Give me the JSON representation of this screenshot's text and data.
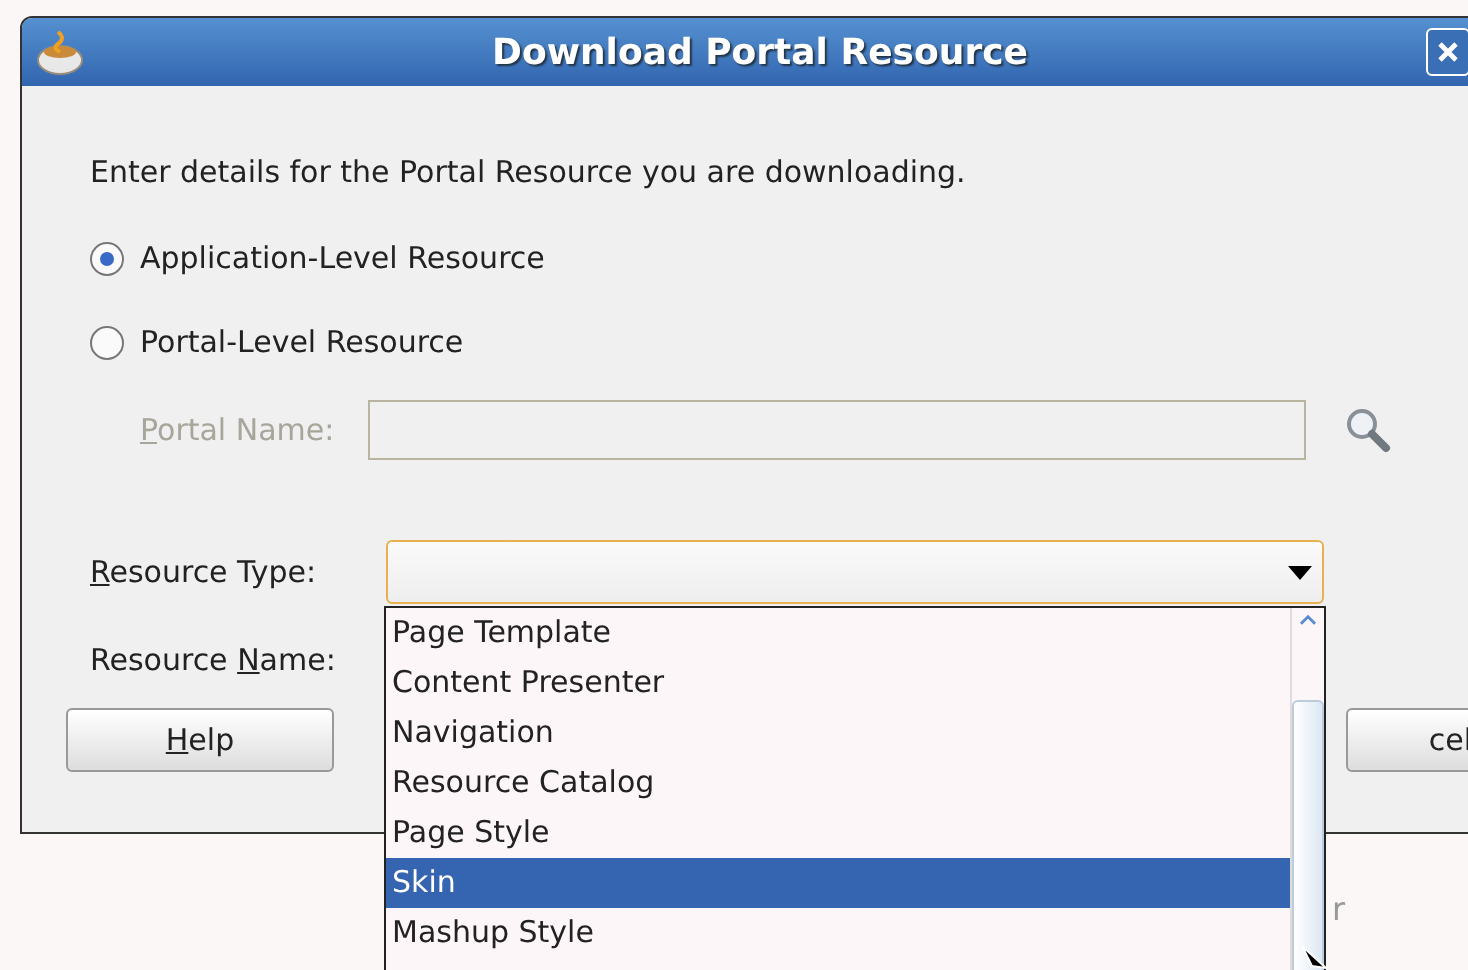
{
  "window": {
    "title": "Download Portal Resource"
  },
  "intro": "Enter details for the Portal Resource you are downloading.",
  "radios": [
    {
      "label": "Application-Level Resource",
      "selected": true
    },
    {
      "label": "Portal-Level Resource",
      "selected": false
    }
  ],
  "portal_name": {
    "label": {
      "key": "P",
      "post": "ortal Name:"
    },
    "disabled": true
  },
  "resource_type": {
    "label": {
      "key": "R",
      "post": "esource Type:"
    }
  },
  "resource_name": {
    "label": {
      "pre": "Resource ",
      "key": "N",
      "post": "ame:"
    }
  },
  "dropdown": {
    "items": [
      {
        "label": "Page Template",
        "selected": false
      },
      {
        "label": "Content Presenter",
        "selected": false
      },
      {
        "label": "Navigation",
        "selected": false
      },
      {
        "label": "Resource Catalog",
        "selected": false
      },
      {
        "label": "Page Style",
        "selected": false
      },
      {
        "label": "Skin",
        "selected": true
      },
      {
        "label": "Mashup Style",
        "selected": false
      }
    ]
  },
  "buttons": [
    {
      "kind": "help",
      "label": {
        "key": "H",
        "post": "elp"
      }
    },
    {
      "kind": "cancel",
      "label": {
        "post": "cel"
      }
    }
  ],
  "background_text": "r"
}
